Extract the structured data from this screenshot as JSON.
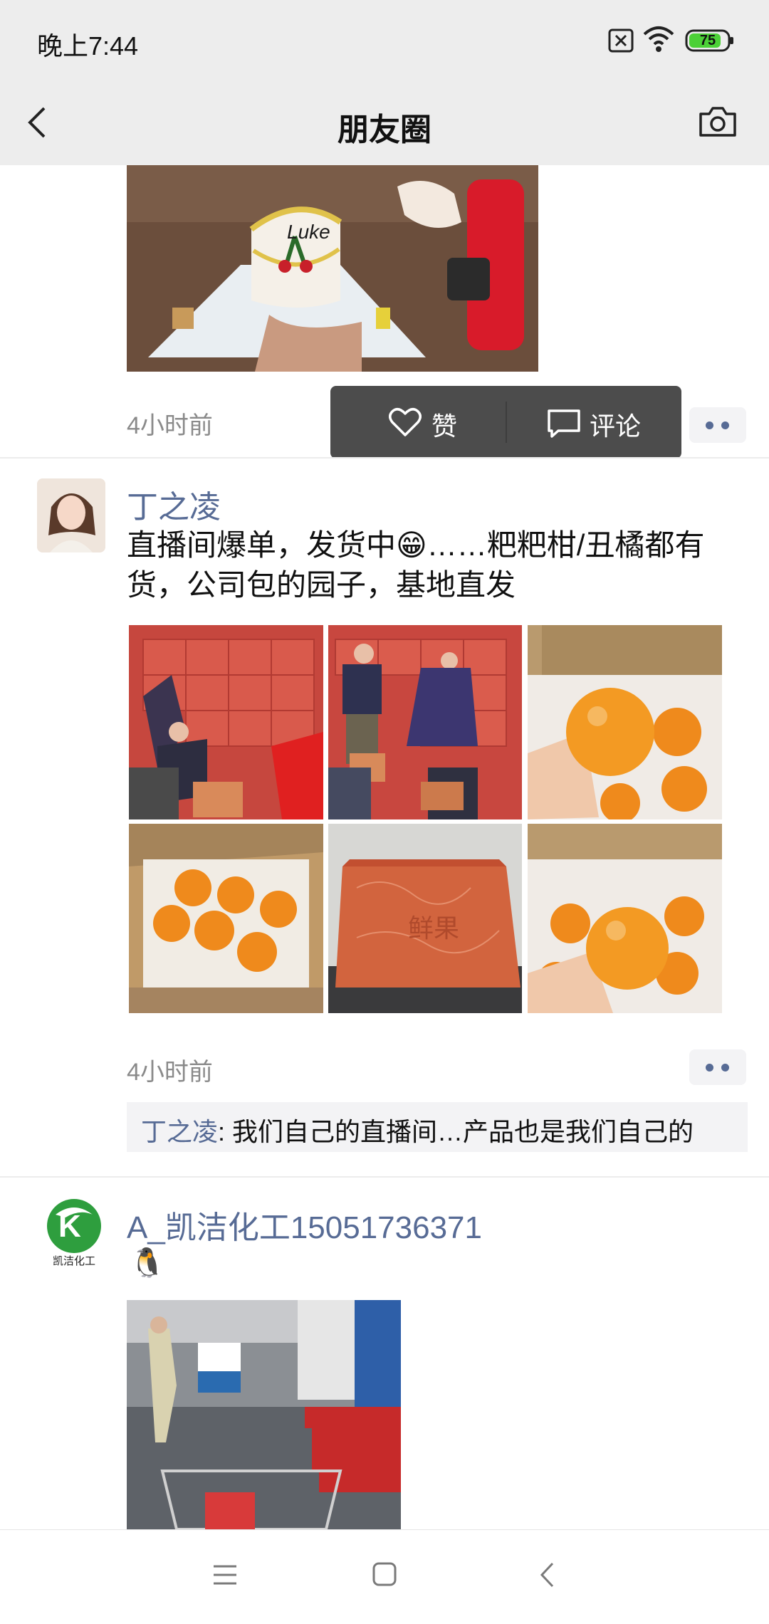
{
  "status_bar": {
    "time": "晚上7:44",
    "battery": "75"
  },
  "header": {
    "title": "朋友圈"
  },
  "colors": {
    "link": "#576b95",
    "battery_green": "#4cd137",
    "header_bg": "#ededed"
  },
  "posts": [
    {
      "timestamp": "4小时前",
      "photo_caption": "Luke",
      "actions": {
        "like_label": "赞",
        "comment_label": "评论"
      }
    },
    {
      "author": "丁之凌",
      "text_line1": "直播间爆单，发货中😁……粑粑柑/丑橘都有",
      "text_line2": "货，公司包的园子，基地直发",
      "box_text": "鲜果",
      "timestamp": "4小时前",
      "comment": {
        "author": "丁之凌",
        "text": ": 我们自己的直播间…产品也是我们自己的"
      }
    },
    {
      "author": "A_凯洁化工15051736371",
      "avatar_text": "凯洁化工",
      "avatar_letter": "K",
      "emoji": "🐧"
    }
  ],
  "icons": [
    "back-icon",
    "camera-icon",
    "heart-icon",
    "comment-icon",
    "more-icon",
    "menu-icon",
    "home-icon",
    "nav-back-icon",
    "wifi-icon",
    "sim-icon",
    "battery-icon"
  ]
}
